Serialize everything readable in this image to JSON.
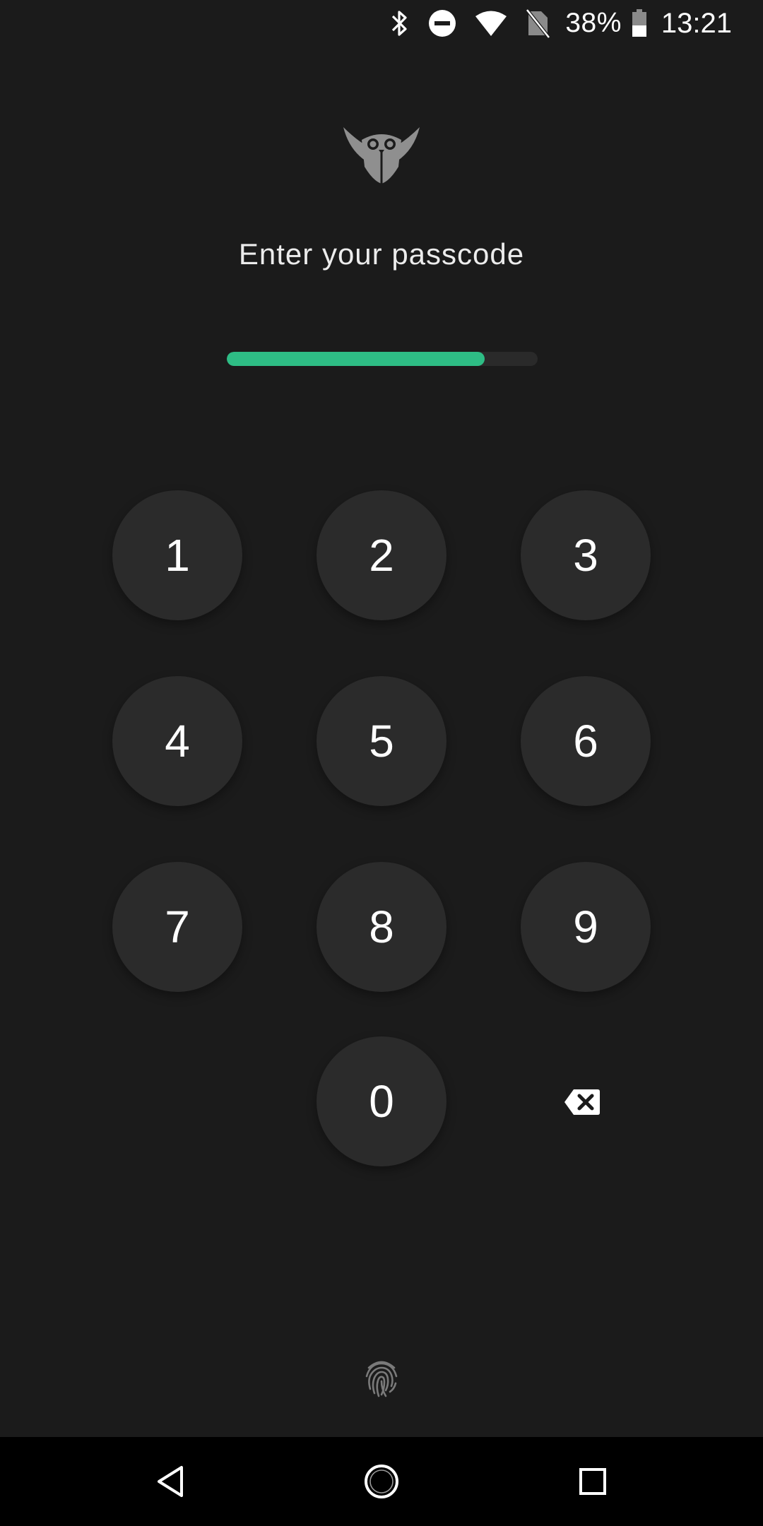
{
  "status_bar": {
    "icons": [
      "bluetooth-icon",
      "do-not-disturb-icon",
      "wifi-icon",
      "no-sim-icon"
    ],
    "battery_percent": "38%",
    "battery_icon": "battery-icon",
    "time": "13:21"
  },
  "app": {
    "logo_icon": "owl-logo-icon"
  },
  "passcode": {
    "prompt": "Enter your passcode",
    "progress_fraction": 0.83,
    "accent_color": "#2ebd85"
  },
  "keypad": {
    "keys": [
      "1",
      "2",
      "3",
      "4",
      "5",
      "6",
      "7",
      "8",
      "9",
      "0"
    ],
    "backspace_icon": "backspace-icon"
  },
  "biometric": {
    "icon": "fingerprint-icon"
  },
  "nav_bar": {
    "back_icon": "back-triangle-icon",
    "home_icon": "home-circle-icon",
    "recents_icon": "recents-square-icon"
  }
}
